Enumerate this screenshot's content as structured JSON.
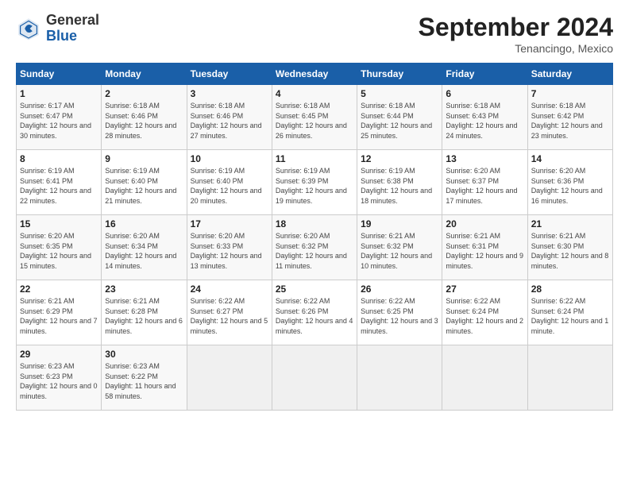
{
  "header": {
    "logo_general": "General",
    "logo_blue": "Blue",
    "month_title": "September 2024",
    "location": "Tenancingo, Mexico"
  },
  "weekdays": [
    "Sunday",
    "Monday",
    "Tuesday",
    "Wednesday",
    "Thursday",
    "Friday",
    "Saturday"
  ],
  "weeks": [
    [
      {
        "day": "1",
        "sunrise": "Sunrise: 6:17 AM",
        "sunset": "Sunset: 6:47 PM",
        "daylight": "Daylight: 12 hours and 30 minutes."
      },
      {
        "day": "2",
        "sunrise": "Sunrise: 6:18 AM",
        "sunset": "Sunset: 6:46 PM",
        "daylight": "Daylight: 12 hours and 28 minutes."
      },
      {
        "day": "3",
        "sunrise": "Sunrise: 6:18 AM",
        "sunset": "Sunset: 6:46 PM",
        "daylight": "Daylight: 12 hours and 27 minutes."
      },
      {
        "day": "4",
        "sunrise": "Sunrise: 6:18 AM",
        "sunset": "Sunset: 6:45 PM",
        "daylight": "Daylight: 12 hours and 26 minutes."
      },
      {
        "day": "5",
        "sunrise": "Sunrise: 6:18 AM",
        "sunset": "Sunset: 6:44 PM",
        "daylight": "Daylight: 12 hours and 25 minutes."
      },
      {
        "day": "6",
        "sunrise": "Sunrise: 6:18 AM",
        "sunset": "Sunset: 6:43 PM",
        "daylight": "Daylight: 12 hours and 24 minutes."
      },
      {
        "day": "7",
        "sunrise": "Sunrise: 6:18 AM",
        "sunset": "Sunset: 6:42 PM",
        "daylight": "Daylight: 12 hours and 23 minutes."
      }
    ],
    [
      {
        "day": "8",
        "sunrise": "Sunrise: 6:19 AM",
        "sunset": "Sunset: 6:41 PM",
        "daylight": "Daylight: 12 hours and 22 minutes."
      },
      {
        "day": "9",
        "sunrise": "Sunrise: 6:19 AM",
        "sunset": "Sunset: 6:40 PM",
        "daylight": "Daylight: 12 hours and 21 minutes."
      },
      {
        "day": "10",
        "sunrise": "Sunrise: 6:19 AM",
        "sunset": "Sunset: 6:40 PM",
        "daylight": "Daylight: 12 hours and 20 minutes."
      },
      {
        "day": "11",
        "sunrise": "Sunrise: 6:19 AM",
        "sunset": "Sunset: 6:39 PM",
        "daylight": "Daylight: 12 hours and 19 minutes."
      },
      {
        "day": "12",
        "sunrise": "Sunrise: 6:19 AM",
        "sunset": "Sunset: 6:38 PM",
        "daylight": "Daylight: 12 hours and 18 minutes."
      },
      {
        "day": "13",
        "sunrise": "Sunrise: 6:20 AM",
        "sunset": "Sunset: 6:37 PM",
        "daylight": "Daylight: 12 hours and 17 minutes."
      },
      {
        "day": "14",
        "sunrise": "Sunrise: 6:20 AM",
        "sunset": "Sunset: 6:36 PM",
        "daylight": "Daylight: 12 hours and 16 minutes."
      }
    ],
    [
      {
        "day": "15",
        "sunrise": "Sunrise: 6:20 AM",
        "sunset": "Sunset: 6:35 PM",
        "daylight": "Daylight: 12 hours and 15 minutes."
      },
      {
        "day": "16",
        "sunrise": "Sunrise: 6:20 AM",
        "sunset": "Sunset: 6:34 PM",
        "daylight": "Daylight: 12 hours and 14 minutes."
      },
      {
        "day": "17",
        "sunrise": "Sunrise: 6:20 AM",
        "sunset": "Sunset: 6:33 PM",
        "daylight": "Daylight: 12 hours and 13 minutes."
      },
      {
        "day": "18",
        "sunrise": "Sunrise: 6:20 AM",
        "sunset": "Sunset: 6:32 PM",
        "daylight": "Daylight: 12 hours and 11 minutes."
      },
      {
        "day": "19",
        "sunrise": "Sunrise: 6:21 AM",
        "sunset": "Sunset: 6:32 PM",
        "daylight": "Daylight: 12 hours and 10 minutes."
      },
      {
        "day": "20",
        "sunrise": "Sunrise: 6:21 AM",
        "sunset": "Sunset: 6:31 PM",
        "daylight": "Daylight: 12 hours and 9 minutes."
      },
      {
        "day": "21",
        "sunrise": "Sunrise: 6:21 AM",
        "sunset": "Sunset: 6:30 PM",
        "daylight": "Daylight: 12 hours and 8 minutes."
      }
    ],
    [
      {
        "day": "22",
        "sunrise": "Sunrise: 6:21 AM",
        "sunset": "Sunset: 6:29 PM",
        "daylight": "Daylight: 12 hours and 7 minutes."
      },
      {
        "day": "23",
        "sunrise": "Sunrise: 6:21 AM",
        "sunset": "Sunset: 6:28 PM",
        "daylight": "Daylight: 12 hours and 6 minutes."
      },
      {
        "day": "24",
        "sunrise": "Sunrise: 6:22 AM",
        "sunset": "Sunset: 6:27 PM",
        "daylight": "Daylight: 12 hours and 5 minutes."
      },
      {
        "day": "25",
        "sunrise": "Sunrise: 6:22 AM",
        "sunset": "Sunset: 6:26 PM",
        "daylight": "Daylight: 12 hours and 4 minutes."
      },
      {
        "day": "26",
        "sunrise": "Sunrise: 6:22 AM",
        "sunset": "Sunset: 6:25 PM",
        "daylight": "Daylight: 12 hours and 3 minutes."
      },
      {
        "day": "27",
        "sunrise": "Sunrise: 6:22 AM",
        "sunset": "Sunset: 6:24 PM",
        "daylight": "Daylight: 12 hours and 2 minutes."
      },
      {
        "day": "28",
        "sunrise": "Sunrise: 6:22 AM",
        "sunset": "Sunset: 6:24 PM",
        "daylight": "Daylight: 12 hours and 1 minute."
      }
    ],
    [
      {
        "day": "29",
        "sunrise": "Sunrise: 6:23 AM",
        "sunset": "Sunset: 6:23 PM",
        "daylight": "Daylight: 12 hours and 0 minutes."
      },
      {
        "day": "30",
        "sunrise": "Sunrise: 6:23 AM",
        "sunset": "Sunset: 6:22 PM",
        "daylight": "Daylight: 11 hours and 58 minutes."
      },
      null,
      null,
      null,
      null,
      null
    ]
  ]
}
